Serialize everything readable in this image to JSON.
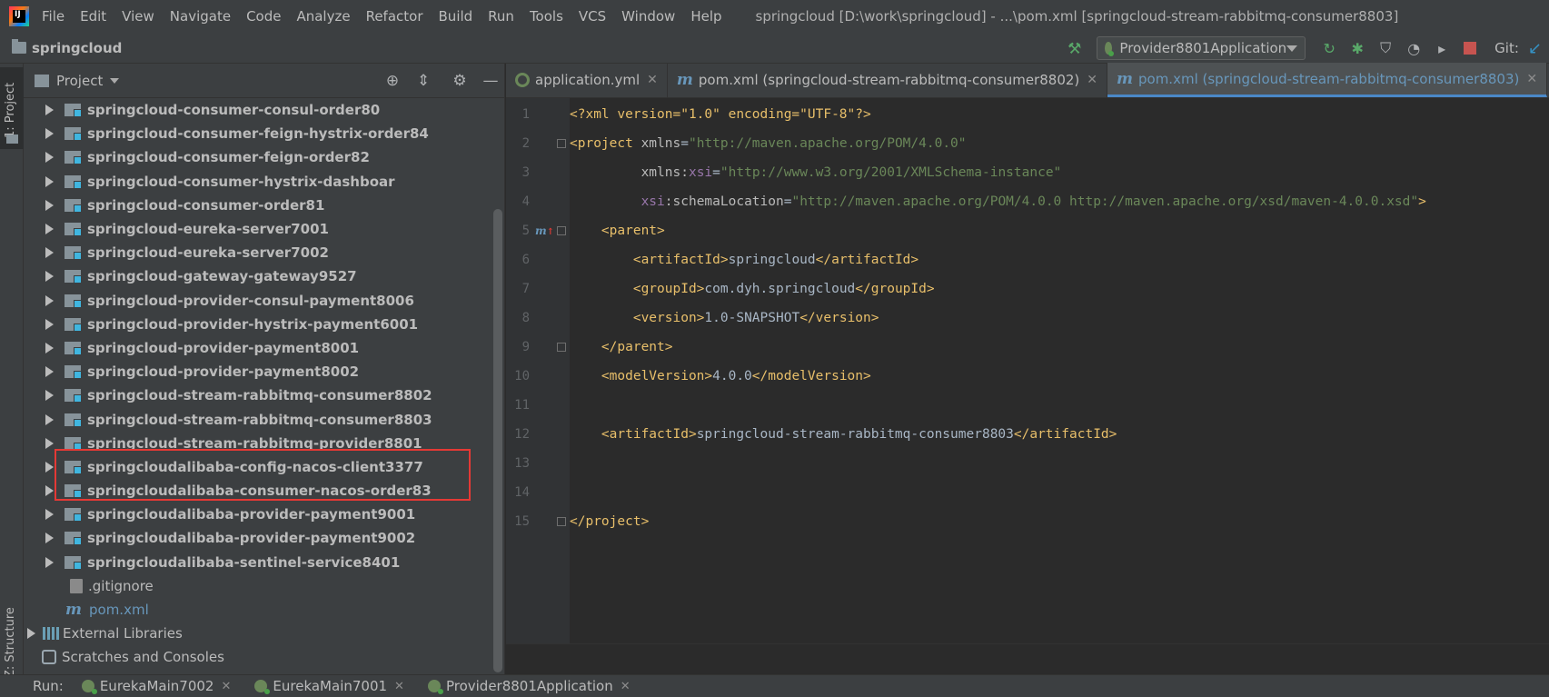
{
  "menubar": {
    "logo_text": "IJ",
    "items": [
      "File",
      "Edit",
      "View",
      "Navigate",
      "Code",
      "Analyze",
      "Refactor",
      "Build",
      "Run",
      "Tools",
      "VCS",
      "Window",
      "Help"
    ],
    "window_title": "springcloud [D:\\work\\springcloud] - ...\\pom.xml [springcloud-stream-rabbitmq-consumer8803]"
  },
  "navbar": {
    "project_name": "springcloud",
    "run_config": "Provider8801Application",
    "git_label": "Git:"
  },
  "left_stripe": {
    "project_label": "1: Project",
    "structure_label": "Z: Structure"
  },
  "project_panel": {
    "title": "Project",
    "modules": [
      "springcloud-consumer-consul-order80",
      "springcloud-consumer-feign-hystrix-order84",
      "springcloud-consumer-feign-order82",
      "springcloud-consumer-hystrix-dashboar",
      "springcloud-consumer-order81",
      "springcloud-eureka-server7001",
      "springcloud-eureka-server7002",
      "springcloud-gateway-gateway9527",
      "springcloud-provider-consul-payment8006",
      "springcloud-provider-hystrix-payment6001",
      "springcloud-provider-payment8001",
      "springcloud-provider-payment8002",
      "springcloud-stream-rabbitmq-consumer8802",
      "springcloud-stream-rabbitmq-consumer8803",
      "springcloud-stream-rabbitmq-provider8801",
      "springcloudalibaba-config-nacos-client3377",
      "springcloudalibaba-consumer-nacos-order83",
      "springcloudalibaba-provider-payment9001",
      "springcloudalibaba-provider-payment9002",
      "springcloudalibaba-sentinel-service8401"
    ],
    "gitignore": ".gitignore",
    "pom": "pom.xml",
    "pom_icon": "m",
    "external_libraries": "External Libraries",
    "scratches": "Scratches and Consoles"
  },
  "editor": {
    "tabs": [
      {
        "label": "application.yml",
        "active": false
      },
      {
        "label": "pom.xml (springcloud-stream-rabbitmq-consumer8802)",
        "active": false
      },
      {
        "label": "pom.xml (springcloud-stream-rabbitmq-consumer8803)",
        "active": true
      }
    ],
    "tab_icon_m": "m",
    "line_numbers": [
      "1",
      "2",
      "3",
      "4",
      "5",
      "6",
      "7",
      "8",
      "9",
      "10",
      "11",
      "12",
      "13",
      "14",
      "15"
    ],
    "xml": {
      "decl": "<?xml version=\"1.0\" encoding=\"UTF-8\"?>",
      "xmlns": "\"http://maven.apache.org/POM/4.0.0\"",
      "xsi": "\"http://www.w3.org/2001/XMLSchema-instance\"",
      "schema": "\"http://maven.apache.org/POM/4.0.0 http://maven.apache.org/xsd/maven-4.0.0.xsd\"",
      "artifact_parent": "springcloud",
      "group_id": "com.dyh.springcloud",
      "version": "1.0-SNAPSHOT",
      "model_version": "4.0.0",
      "artifact_id": "springcloud-stream-rabbitmq-consumer8803"
    }
  },
  "runbar": {
    "label": "Run:",
    "tabs": [
      "EurekaMain7002",
      "EurekaMain7001",
      "Provider8801Application"
    ]
  },
  "colors": {
    "highlight": "#e53935",
    "accent": "#4a88c7",
    "xml_tag": "#e8bf6a",
    "xml_string": "#6a8759"
  }
}
